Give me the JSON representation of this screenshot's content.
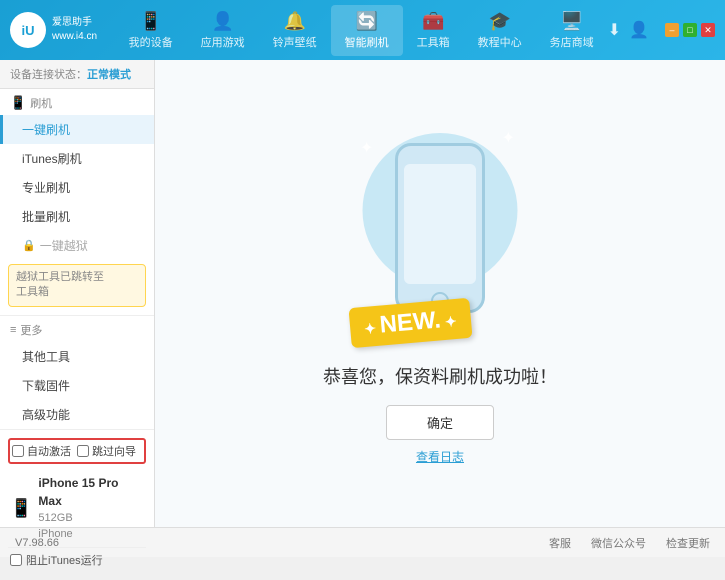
{
  "header": {
    "logo_text_line1": "爱思助手",
    "logo_text_line2": "www.i4.cn",
    "logo_abbr": "iU",
    "nav": [
      {
        "id": "my-device",
        "icon": "📱",
        "label": "我的设备"
      },
      {
        "id": "apps-games",
        "icon": "👤",
        "label": "应用游戏"
      },
      {
        "id": "ringtones",
        "icon": "🔔",
        "label": "铃声壁纸"
      },
      {
        "id": "smart-flash",
        "icon": "🔄",
        "label": "智能刷机",
        "active": true
      },
      {
        "id": "toolbox",
        "icon": "🧰",
        "label": "工具箱"
      },
      {
        "id": "tutorial",
        "icon": "🎓",
        "label": "教程中心"
      },
      {
        "id": "service",
        "icon": "🖥️",
        "label": "务店商域"
      }
    ],
    "win_controls": [
      "–",
      "□",
      "✕"
    ]
  },
  "status_bar": {
    "label": "设备连接状态：",
    "value": "正常模式"
  },
  "sidebar": {
    "flash_group_label": "刷机",
    "flash_group_icon": "📱",
    "items": [
      {
        "id": "one-click-flash",
        "label": "一键刷机",
        "active": true
      },
      {
        "id": "itunes-flash",
        "label": "iTunes刷机"
      },
      {
        "id": "pro-flash",
        "label": "专业刷机"
      },
      {
        "id": "batch-flash",
        "label": "批量刷机"
      }
    ],
    "disabled_label": "一键越狱",
    "notice": "越狱工具已跳转至\n工具箱",
    "more_group_label": "更多",
    "more_items": [
      {
        "id": "other-tools",
        "label": "其他工具"
      },
      {
        "id": "download-fw",
        "label": "下载固件"
      },
      {
        "id": "advanced",
        "label": "高级功能"
      }
    ],
    "auto_activate_label": "自动激活",
    "skip_guide_label": "跳过向导",
    "device_name": "iPhone 15 Pro Max",
    "device_storage": "512GB",
    "device_type": "iPhone",
    "itunes_label": "阻止iTunes运行"
  },
  "content": {
    "new_badge": "NEW.",
    "success_text": "恭喜您，保资料刷机成功啦！",
    "confirm_btn": "确定",
    "log_link": "查看日志"
  },
  "footer": {
    "version": "V7.98.66",
    "items": [
      "客服",
      "微信公众号",
      "检查更新"
    ]
  }
}
